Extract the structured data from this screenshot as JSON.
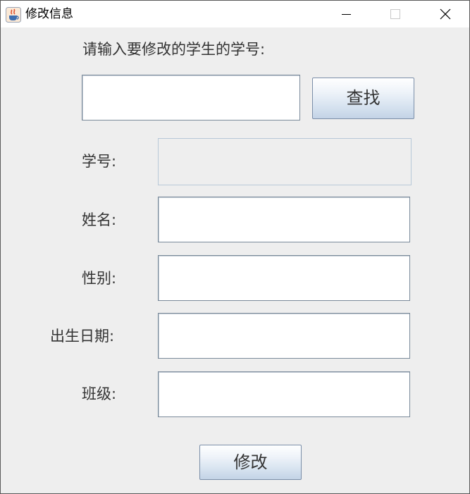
{
  "window": {
    "title": "修改信息",
    "icons": {
      "app": "java-cup-icon",
      "minimize": "minimize-icon",
      "maximize": "maximize-icon",
      "close": "close-icon"
    }
  },
  "prompt": "请输入要修改的学生的学号:",
  "search": {
    "value": "",
    "button_label": "查找"
  },
  "form": {
    "student_id_label": "学号:",
    "name_label": "姓名:",
    "gender_label": "性别:",
    "birth_date_label": "出生日期:",
    "class_label": "班级:"
  },
  "submit_label": "修改"
}
